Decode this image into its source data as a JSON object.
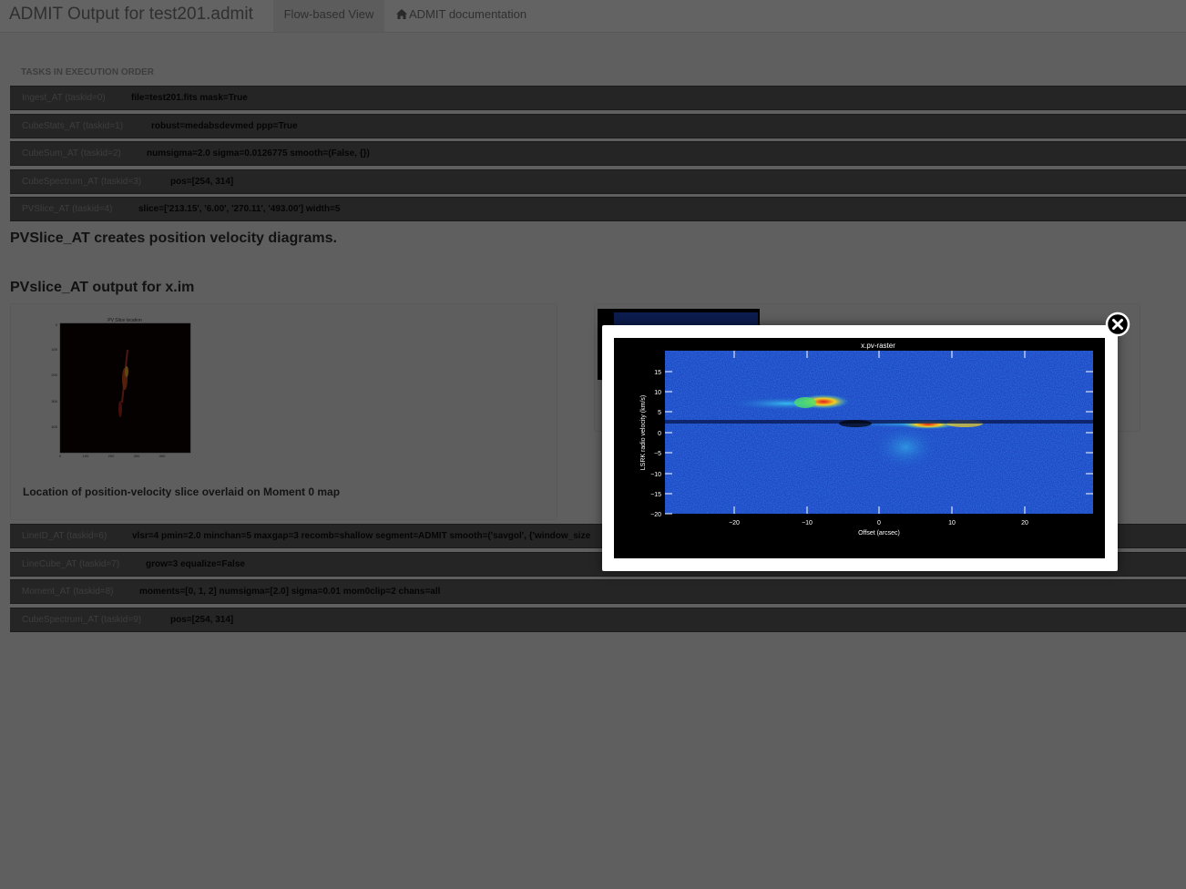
{
  "header": {
    "title": "ADMIT Output for test201.admit",
    "nav_flow": "Flow-based View",
    "nav_doc": "ADMIT documentation"
  },
  "section_label": "TASKS IN EXECUTION ORDER",
  "tasks": [
    {
      "name": "Ingest_AT (taskid=0)",
      "params": "file=test201.fits mask=True"
    },
    {
      "name": "CubeStats_AT (taskid=1)",
      "params": "robust=medabsdevmed ppp=True"
    },
    {
      "name": "CubeSum_AT (taskid=2)",
      "params": "numsigma=2.0 sigma=0.0126775 smooth=(False, {})"
    },
    {
      "name": "CubeSpectrum_AT (taskid=3)",
      "params": "pos=[254, 314]"
    },
    {
      "name": "PVSlice_AT (taskid=4)",
      "params": "slice=['213.15', '6.00', '270.11', '493.00'] width=5"
    },
    {
      "name": "LineID_AT (taskid=6)",
      "params": "vlsr=4 pmin=2.0 minchan=5 maxgap=3 recomb=shallow segment=ADMIT smooth=('savgol', {'window_size"
    },
    {
      "name": "LineCube_AT (taskid=7)",
      "params": "grow=3 equalize=False"
    },
    {
      "name": "Moment_AT (taskid=8)",
      "params": "moments=[0, 1, 2] numsigma=[2.0] sigma=0.01 mom0clip=2 chans=all"
    },
    {
      "name": "CubeSpectrum_AT (taskid=9)",
      "params": "pos=[254, 314]"
    }
  ],
  "pvslice": {
    "description": "PVSlice_AT creates position velocity diagrams.",
    "output_heading": "PVslice_AT output for x.im",
    "moment_caption": "Location of position-velocity slice overlaid on Moment 0 map",
    "moment_plot": {
      "title": "PV Slice location",
      "yticks": [
        "0",
        "100",
        "200",
        "300",
        "400"
      ],
      "xticks": [
        "0",
        "100",
        "200",
        "300",
        "400"
      ]
    }
  },
  "modal": {
    "plot_title": "x.pv-raster",
    "xlabel": "Offset (arcsec)",
    "ylabel": "LSRK radio velocity (km/s)",
    "xticks": [
      "−20",
      "−10",
      "0",
      "10",
      "20"
    ],
    "yticks": [
      "15",
      "10",
      "5",
      "0",
      "−5",
      "−10",
      "−15",
      "−20"
    ]
  },
  "colors": {
    "page_bg": "#eeeeee",
    "task_row_bg": "#5c5c5c",
    "modal_bg": "#ffffff",
    "plot_bg": "#000000",
    "pv_colormap_base": "#1d48c4"
  },
  "icons": {
    "home": "home-icon",
    "close": "close-icon"
  }
}
